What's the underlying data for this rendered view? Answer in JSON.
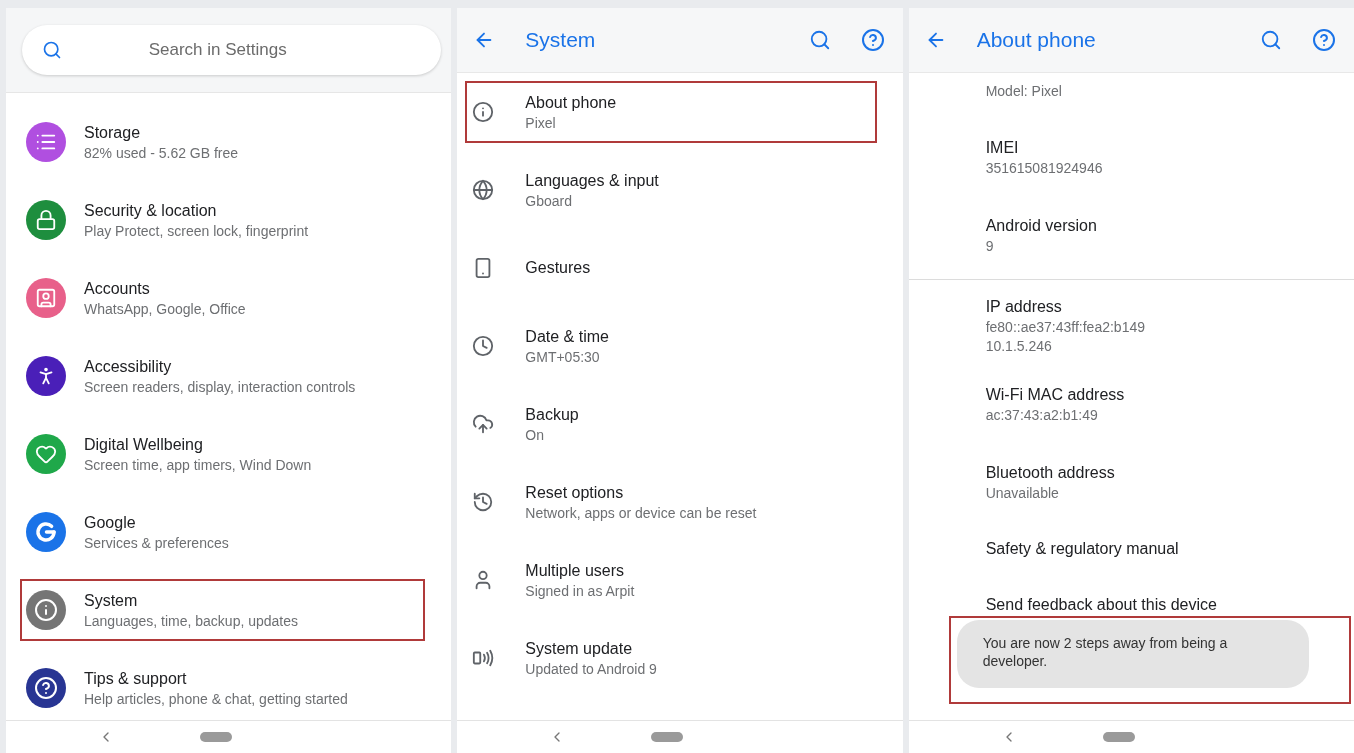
{
  "home": {
    "search": {
      "placeholder": "Search in Settings"
    },
    "items": [
      {
        "title": "Storage",
        "subtitle": "82% used - 5.62 GB free",
        "color": "#b04fe0",
        "highlighted": false
      },
      {
        "title": "Security & location",
        "subtitle": "Play Protect, screen lock, fingerprint",
        "color": "#1e8e3e",
        "highlighted": false
      },
      {
        "title": "Accounts",
        "subtitle": "WhatsApp, Google, Office",
        "color": "#e8608a",
        "highlighted": false
      },
      {
        "title": "Accessibility",
        "subtitle": "Screen readers, display, interaction controls",
        "color": "#4a1fb8",
        "highlighted": false
      },
      {
        "title": "Digital Wellbeing",
        "subtitle": "Screen time, app timers, Wind Down",
        "color": "#1fa84a",
        "highlighted": false
      },
      {
        "title": "Google",
        "subtitle": "Services & preferences",
        "color": "#1a73e8",
        "highlighted": false
      },
      {
        "title": "System",
        "subtitle": "Languages, time, backup, updates",
        "color": "#757575",
        "highlighted": true
      },
      {
        "title": "Tips & support",
        "subtitle": "Help articles, phone & chat, getting started",
        "color": "#283593",
        "highlighted": false
      }
    ]
  },
  "system": {
    "title": "System",
    "items": [
      {
        "title": "About phone",
        "subtitle": "Pixel",
        "highlighted": true
      },
      {
        "title": "Languages & input",
        "subtitle": "Gboard",
        "highlighted": false
      },
      {
        "title": "Gestures",
        "highlighted": false
      },
      {
        "title": "Date & time",
        "subtitle": "GMT+05:30",
        "highlighted": false
      },
      {
        "title": "Backup",
        "subtitle": "On",
        "highlighted": false
      },
      {
        "title": "Reset options",
        "subtitle": "Network, apps or device can be reset",
        "highlighted": false
      },
      {
        "title": "Multiple users",
        "subtitle": "Signed in as Arpit",
        "highlighted": false
      },
      {
        "title": "System update",
        "subtitle": "Updated to Android 9",
        "highlighted": false
      }
    ]
  },
  "about": {
    "title": "About phone",
    "groups": [
      [
        {
          "values": [
            "Model: Pixel"
          ]
        },
        {
          "title": "IMEI",
          "values": [
            "351615081924946"
          ]
        },
        {
          "title": "Android version",
          "values": [
            "9"
          ]
        }
      ],
      [
        {
          "title": "IP address",
          "values": [
            "fe80::ae37:43ff:fea2:b149",
            "10.1.5.246"
          ]
        },
        {
          "title": "Wi-Fi MAC address",
          "values": [
            "ac:37:43:a2:b1:49"
          ]
        },
        {
          "title": "Bluetooth address",
          "values": [
            "Unavailable"
          ]
        },
        {
          "title": "Safety & regulatory manual"
        },
        {
          "title": "Send feedback about this device"
        }
      ]
    ],
    "toast": {
      "text": "You are now 2 steps away from being a developer.",
      "highlighted": true
    }
  }
}
